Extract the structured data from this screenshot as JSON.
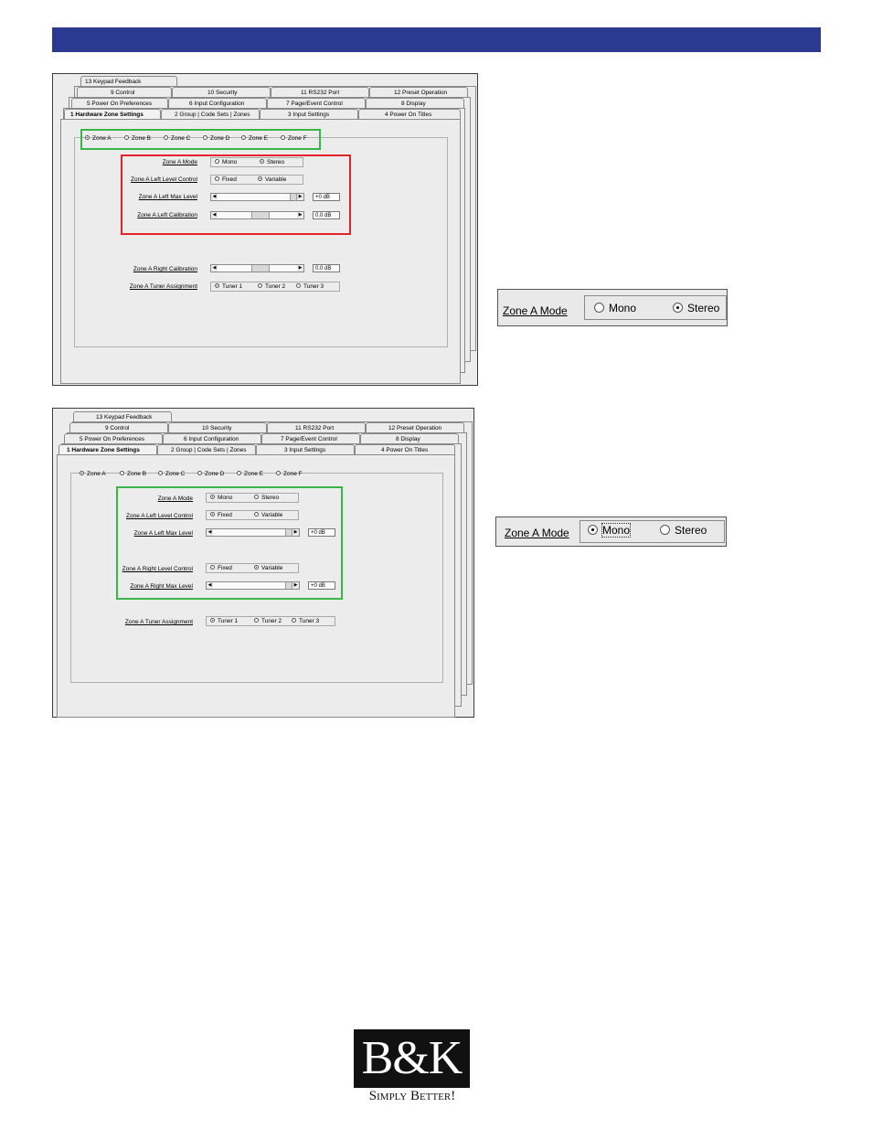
{
  "tabs": {
    "row4": [
      "13 Keypad Feedback"
    ],
    "row3": [
      "9  Control",
      "10  Security",
      "11  RS232 Port",
      "12  Preset Operation"
    ],
    "row2": [
      "5  Power On Preferences",
      "6  Input Configuration",
      "7  Page/Event Control",
      "8  Display"
    ],
    "row1": [
      "1  Hardware Zone Settings",
      "2 Group | Code Sets | Zones",
      "3  Input Settings",
      "4  Power On Titles"
    ]
  },
  "zones": [
    "Zone A",
    "Zone B",
    "Zone C",
    "Zone D",
    "Zone E",
    "Zone F"
  ],
  "shot1": {
    "mode_label": "Zone A Mode",
    "mode_options": [
      "Mono",
      "Stereo"
    ],
    "left_level_label": "Zone A Left Level Control",
    "level_options": [
      "Fixed",
      "Variable"
    ],
    "left_max_label": "Zone A Left Max Level",
    "left_max_value": "+0 dB",
    "left_cal_label": "Zone A Left Calibration",
    "left_cal_value": "0.0 dB",
    "right_cal_label": "Zone A Right Calibration",
    "right_cal_value": "0.0 dB",
    "tuner_label": "Zone A Tuner Assignment",
    "tuner_options": [
      "Tuner 1",
      "Tuner 2",
      "Tuner 3"
    ]
  },
  "shot2": {
    "mode_label": "Zone A Mode",
    "mode_options": [
      "Mono",
      "Stereo"
    ],
    "left_level_label": "Zone A Left Level Control",
    "level_options": [
      "Fixed",
      "Variable"
    ],
    "left_max_label": "Zone A Left Max Level",
    "left_max_value": "+0 dB",
    "right_level_label": "Zone A Right Level Control",
    "right_max_label": "Zone A Right Max Level",
    "right_max_value": "+0 dB",
    "tuner_label": "Zone A Tuner Assignment",
    "tuner_options": [
      "Tuner 1",
      "Tuner 2",
      "Tuner 3"
    ]
  },
  "zoom1": {
    "label": "Zone A Mode",
    "options": [
      "Mono",
      "Stereo"
    ]
  },
  "zoom2": {
    "label": "Zone A Mode",
    "options": [
      "Mono",
      "Stereo"
    ]
  },
  "logo": {
    "mark": "B&K",
    "tagline": "Simply Better!"
  }
}
